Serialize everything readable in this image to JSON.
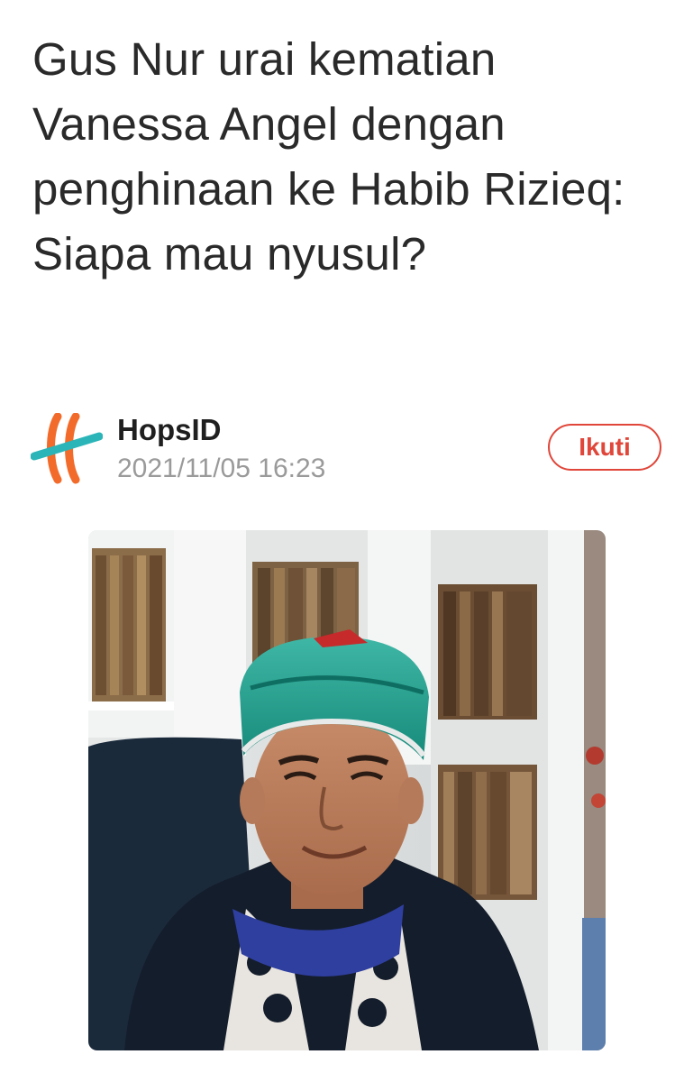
{
  "article": {
    "title": "Gus Nur urai kematian Vanessa Angel dengan penghinaan ke Habib Rizieq: Siapa mau nyusul?"
  },
  "source": {
    "name": "HopsID",
    "published": "2021/11/05 16:23",
    "logo_icon": "hopsid-logo-icon",
    "follow_label": "Ikuti"
  },
  "colors": {
    "accent": "#e0463a",
    "logo_orange": "#f26b2b",
    "logo_teal": "#2bb5b8",
    "meta_gray": "#9a9a9a"
  },
  "image": {
    "subject": "article-photo"
  }
}
